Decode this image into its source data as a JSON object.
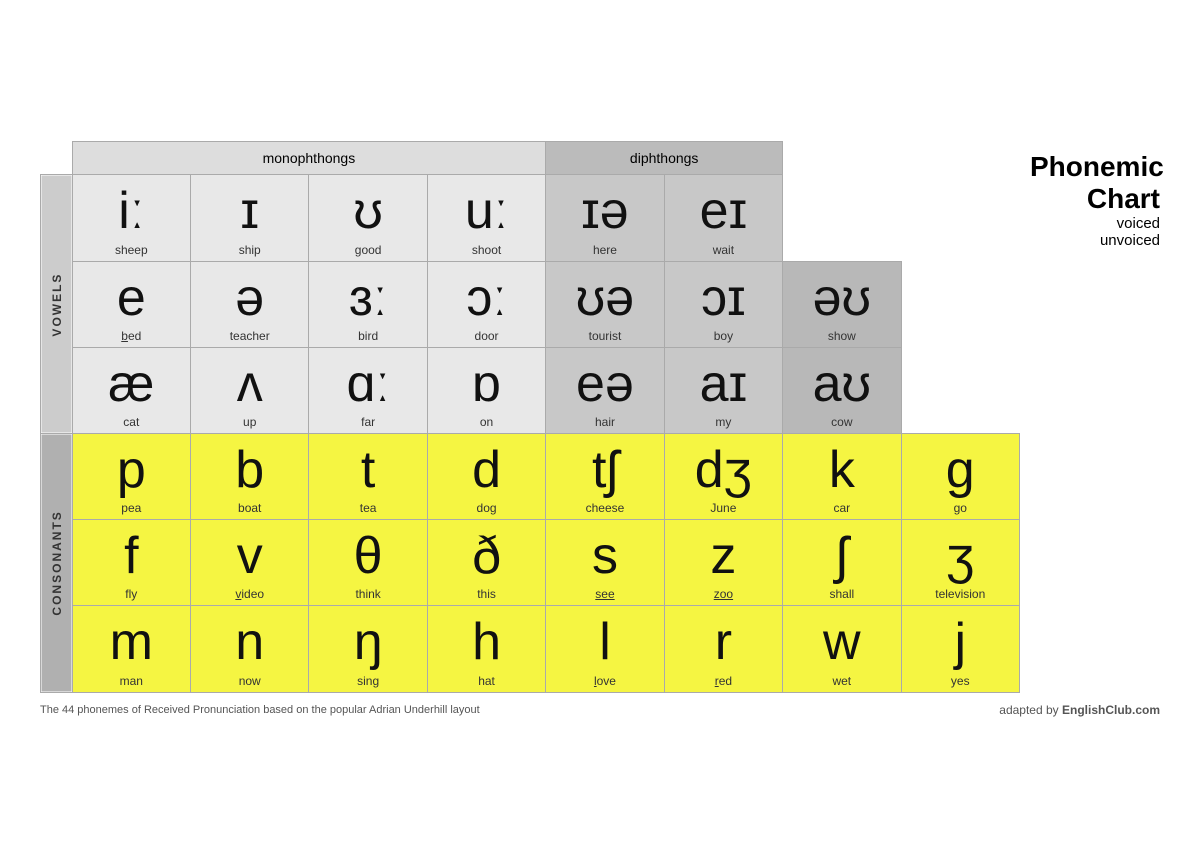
{
  "title": {
    "line1": "Phonemic",
    "line2": "Chart",
    "voiced": "voiced",
    "unvoiced": "unvoiced"
  },
  "headers": {
    "monophthongs": "monophthongs",
    "diphthongs": "diphthongs"
  },
  "vowels_label": "VOWELS",
  "consonants_label": "CONSONANTS",
  "vowel_rows": [
    [
      {
        "symbol": "iː",
        "word": "sheep",
        "type": "vowel"
      },
      {
        "symbol": "ɪ",
        "word": "ship",
        "type": "vowel"
      },
      {
        "symbol": "ʊ",
        "word": "good",
        "type": "vowel"
      },
      {
        "symbol": "uː",
        "word": "shoot",
        "type": "vowel"
      },
      {
        "symbol": "ɪə",
        "word": "here",
        "type": "diphthong"
      },
      {
        "symbol": "eɪ",
        "word": "wait",
        "type": "diphthong"
      }
    ],
    [
      {
        "symbol": "e",
        "word": "bed",
        "type": "vowel"
      },
      {
        "symbol": "ə",
        "word": "teacher",
        "type": "vowel"
      },
      {
        "symbol": "ɜː",
        "word": "bird",
        "type": "vowel"
      },
      {
        "symbol": "ɔː",
        "word": "door",
        "type": "vowel"
      },
      {
        "symbol": "ʊə",
        "word": "tourist",
        "type": "diphthong"
      },
      {
        "symbol": "ɔɪ",
        "word": "boy",
        "type": "diphthong"
      },
      {
        "symbol": "əʊ",
        "word": "show",
        "type": "extra"
      }
    ],
    [
      {
        "symbol": "æ",
        "word": "cat",
        "type": "vowel"
      },
      {
        "symbol": "ʌ",
        "word": "up",
        "type": "vowel"
      },
      {
        "symbol": "ɑː",
        "word": "far",
        "type": "vowel"
      },
      {
        "symbol": "ɒ",
        "word": "on",
        "type": "vowel"
      },
      {
        "symbol": "eə",
        "word": "hair",
        "type": "diphthong"
      },
      {
        "symbol": "aɪ",
        "word": "my",
        "type": "diphthong"
      },
      {
        "symbol": "aʊ",
        "word": "cow",
        "type": "extra"
      }
    ]
  ],
  "consonant_rows": [
    [
      {
        "symbol": "p",
        "word": "pea",
        "underline": ""
      },
      {
        "symbol": "b",
        "word": "boat",
        "underline": ""
      },
      {
        "symbol": "t",
        "word": "tea",
        "underline": ""
      },
      {
        "symbol": "d",
        "word": "dog",
        "underline": ""
      },
      {
        "symbol": "tʃ",
        "word": "cheese",
        "underline": ""
      },
      {
        "symbol": "dʒ",
        "word": "June",
        "underline": ""
      },
      {
        "symbol": "k",
        "word": "car",
        "underline": ""
      },
      {
        "symbol": "g",
        "word": "go",
        "underline": ""
      }
    ],
    [
      {
        "symbol": "f",
        "word": "fly",
        "underline": ""
      },
      {
        "symbol": "v",
        "word": "video",
        "underline": "v"
      },
      {
        "symbol": "θ",
        "word": "think",
        "underline": ""
      },
      {
        "symbol": "ð",
        "word": "this",
        "underline": ""
      },
      {
        "symbol": "s",
        "word": "see",
        "underline": ""
      },
      {
        "symbol": "z",
        "word": "zoo",
        "underline": ""
      },
      {
        "symbol": "ʃ",
        "word": "shall",
        "underline": ""
      },
      {
        "symbol": "ʒ",
        "word": "television",
        "underline": ""
      }
    ],
    [
      {
        "symbol": "m",
        "word": "man",
        "underline": ""
      },
      {
        "symbol": "n",
        "word": "now",
        "underline": ""
      },
      {
        "symbol": "ŋ",
        "word": "sing",
        "underline": ""
      },
      {
        "symbol": "h",
        "word": "hat",
        "underline": ""
      },
      {
        "symbol": "l",
        "word": "love",
        "underline": ""
      },
      {
        "symbol": "r",
        "word": "red",
        "underline": ""
      },
      {
        "symbol": "w",
        "word": "wet",
        "underline": ""
      },
      {
        "symbol": "j",
        "word": "yes",
        "underline": ""
      }
    ]
  ],
  "footer": {
    "left": "The 44 phonemes of Received Pronunciation based on the popular Adrian Underhill layout",
    "right": "adapted by EnglishClub.com"
  }
}
